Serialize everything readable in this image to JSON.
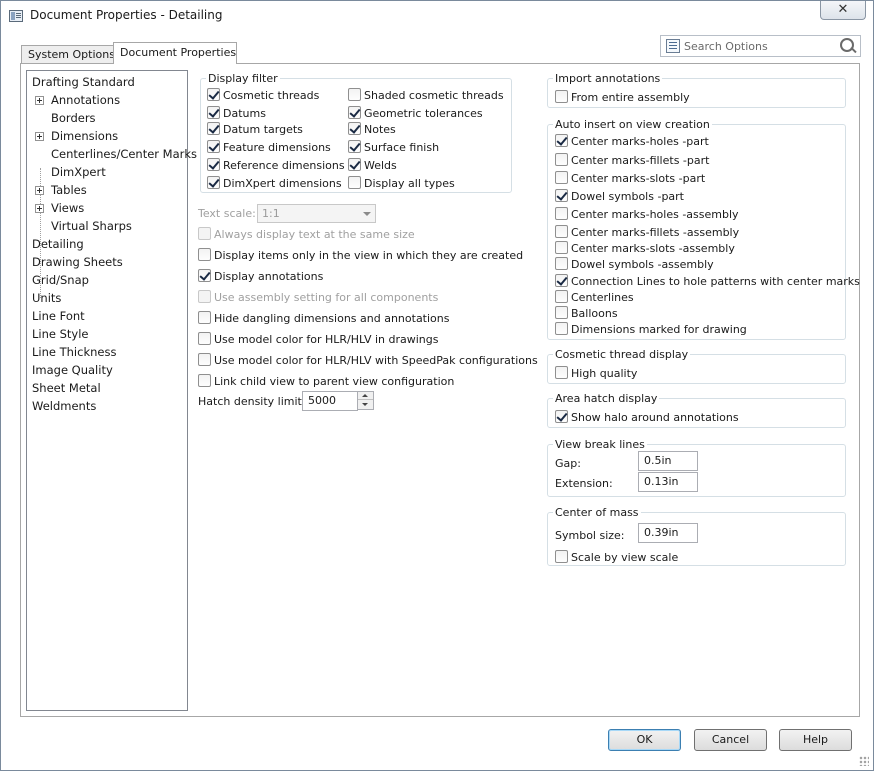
{
  "window": {
    "title": "Document Properties - Detailing",
    "close_glyph": "✕"
  },
  "tabs": [
    {
      "label": "System Options"
    },
    {
      "label": "Document Properties"
    }
  ],
  "search": {
    "placeholder": "Search Options"
  },
  "tree": {
    "items": [
      {
        "label": "Drafting Standard"
      },
      {
        "label": "Annotations"
      },
      {
        "label": "Borders"
      },
      {
        "label": "Dimensions"
      },
      {
        "label": "Centerlines/Center Marks"
      },
      {
        "label": "DimXpert"
      },
      {
        "label": "Tables"
      },
      {
        "label": "Views"
      },
      {
        "label": "Virtual Sharps"
      },
      {
        "label": "Detailing"
      },
      {
        "label": "Drawing Sheets"
      },
      {
        "label": "Grid/Snap"
      },
      {
        "label": "Units"
      },
      {
        "label": "Line Font"
      },
      {
        "label": "Line Style"
      },
      {
        "label": "Line Thickness"
      },
      {
        "label": "Image Quality"
      },
      {
        "label": "Sheet Metal"
      },
      {
        "label": "Weldments"
      }
    ]
  },
  "display_filter": {
    "title": "Display filter",
    "left": [
      {
        "label": "Cosmetic threads",
        "checked": true
      },
      {
        "label": "Datums",
        "checked": true
      },
      {
        "label": "Datum targets",
        "checked": true
      },
      {
        "label": "Feature dimensions",
        "checked": true
      },
      {
        "label": "Reference dimensions",
        "checked": true
      },
      {
        "label": "DimXpert dimensions",
        "checked": true
      }
    ],
    "right": [
      {
        "label": "Shaded cosmetic threads",
        "checked": false
      },
      {
        "label": "Geometric tolerances",
        "checked": true
      },
      {
        "label": "Notes",
        "checked": true
      },
      {
        "label": "Surface finish",
        "checked": true
      },
      {
        "label": "Welds",
        "checked": true
      },
      {
        "label": "Display all types",
        "checked": false
      }
    ]
  },
  "text_scale": {
    "label": "Text scale:",
    "value": "1:1"
  },
  "options": [
    {
      "label": "Always display text at the same size",
      "checked": false,
      "disabled": true
    },
    {
      "label": "Display items only in the view in which they are created",
      "checked": false,
      "disabled": false
    },
    {
      "label": "Display annotations",
      "checked": true,
      "disabled": false
    },
    {
      "label": "Use assembly setting for all components",
      "checked": false,
      "disabled": true
    },
    {
      "label": "Hide dangling dimensions and annotations",
      "checked": false,
      "disabled": false
    },
    {
      "label": "Use model color for HLR/HLV in drawings",
      "checked": false,
      "disabled": false
    },
    {
      "label": "Use model color for HLR/HLV with SpeedPak configurations",
      "checked": false,
      "disabled": false
    },
    {
      "label": "Link child view to parent view configuration",
      "checked": false,
      "disabled": false
    }
  ],
  "hatch": {
    "label": "Hatch density limit:",
    "value": "5000"
  },
  "import_annotations": {
    "title": "Import annotations",
    "items": [
      {
        "label": "From entire assembly",
        "checked": false
      }
    ]
  },
  "auto_insert": {
    "title": "Auto insert on view creation",
    "items": [
      {
        "label": "Center marks-holes -part",
        "checked": true
      },
      {
        "label": "Center marks-fillets -part",
        "checked": false
      },
      {
        "label": "Center marks-slots -part",
        "checked": false
      },
      {
        "label": "Dowel symbols -part",
        "checked": true
      },
      {
        "label": "Center marks-holes -assembly",
        "checked": false
      },
      {
        "label": "Center marks-fillets -assembly",
        "checked": false
      },
      {
        "label": "Center marks-slots -assembly",
        "checked": false
      },
      {
        "label": "Dowel symbols -assembly",
        "checked": false
      },
      {
        "label": "Connection Lines to hole patterns with center marks",
        "checked": true
      },
      {
        "label": "Centerlines",
        "checked": false
      },
      {
        "label": "Balloons",
        "checked": false
      },
      {
        "label": "Dimensions marked for drawing",
        "checked": false
      }
    ]
  },
  "cosmetic_thread": {
    "title": "Cosmetic thread display",
    "items": [
      {
        "label": "High quality",
        "checked": false
      }
    ]
  },
  "area_hatch": {
    "title": "Area hatch display",
    "items": [
      {
        "label": "Show halo around annotations",
        "checked": true
      }
    ]
  },
  "view_break": {
    "title": "View break lines",
    "gap_label": "Gap:",
    "gap_value": "0.5in",
    "ext_label": "Extension:",
    "ext_value": "0.13in"
  },
  "center_of_mass": {
    "title": "Center of mass",
    "symbol_label": "Symbol size:",
    "symbol_value": "0.39in",
    "scale_label": "Scale by view scale",
    "scale_checked": false
  },
  "buttons": {
    "ok": "OK",
    "cancel": "Cancel",
    "help": "Help"
  }
}
